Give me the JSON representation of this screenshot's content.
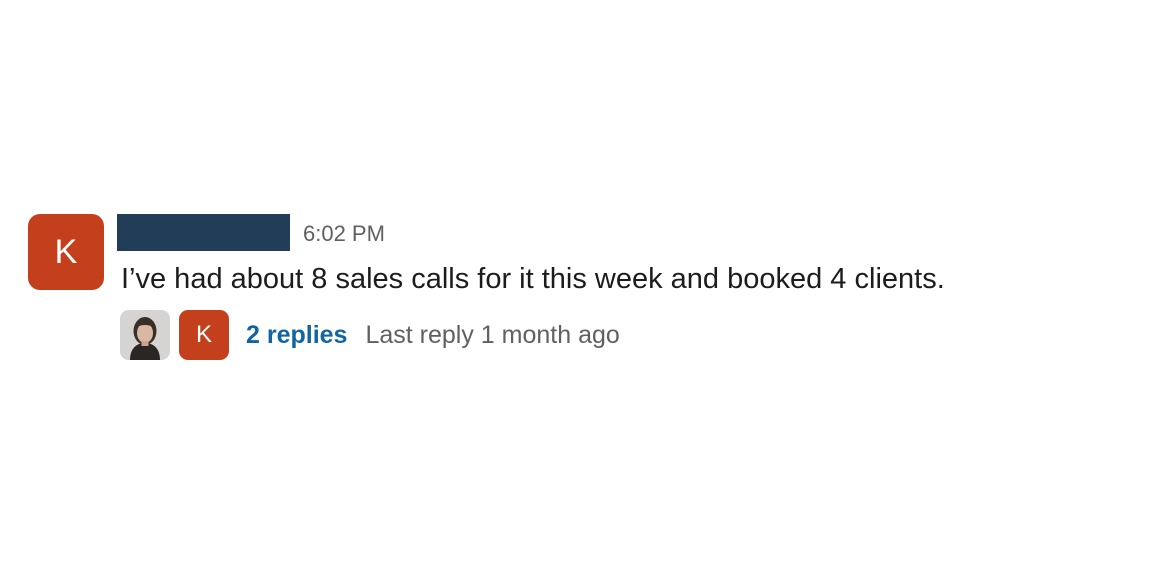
{
  "message": {
    "avatar_letter": "K",
    "sender_redacted": true,
    "timestamp": "6:02 PM",
    "text": "I’ve had about 8 sales calls for it this week and booked 4 clients."
  },
  "thread": {
    "participant_avatars": [
      {
        "type": "photo",
        "icon": "user-photo-avatar"
      },
      {
        "type": "letter",
        "letter": "K"
      }
    ],
    "reply_count": "2 replies",
    "last_reply": "Last reply 1 month ago"
  },
  "colors": {
    "avatar_bg": "#c4401d",
    "redaction_bar": "#223d58",
    "link": "#1264a3",
    "muted": "#616061"
  }
}
